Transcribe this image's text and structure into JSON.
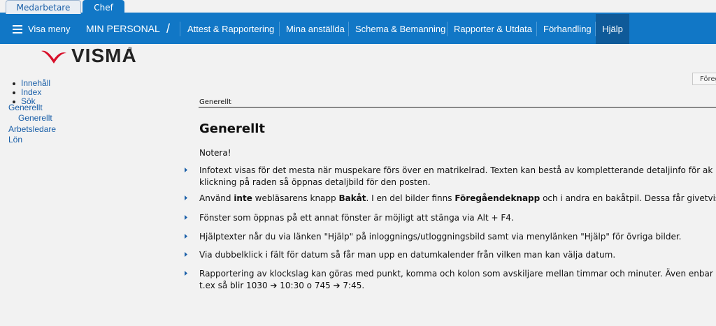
{
  "top_tabs": {
    "employee": "Medarbetare",
    "manager": "Chef"
  },
  "nav": {
    "menu": "Visa meny",
    "section": "MIN PERSONAL",
    "slash": "/",
    "items": [
      "Attest & Rapportering",
      "Mina anställda",
      "Schema & Bemanning",
      "Rapporter & Utdata",
      "Förhandling",
      "Hjälp"
    ]
  },
  "logo": {
    "text": "VISMA",
    "reg": "®"
  },
  "leftnav": {
    "links": [
      "Innehåll",
      "Index",
      "Sök"
    ],
    "tree": [
      "Generellt",
      "Generellt",
      "Arbetsledare",
      "Lön"
    ]
  },
  "prev_button": "Föregående",
  "content": {
    "breadcrumb": "Generellt",
    "title": "Generellt",
    "note": "Notera!",
    "i1a": "Infotext visas för det mesta när muspekare förs över en matrikelrad. Texten kan bestå av kompletterande detaljinfo för ak",
    "i1b": "klickning på raden så öppnas detaljbild för den posten.",
    "i2a": "Använd ",
    "i2b": "inte",
    "i2c": " webläsarens knapp ",
    "i2d": "Bakåt",
    "i2e": ". I en del bilder finns ",
    "i2f": "Föregåendeknapp",
    "i2g": " och i andra en bakåtpil. Dessa får givetvis",
    "i3": "Fönster som öppnas på ett annat fönster är möjligt att stänga via Alt + F4.",
    "i4": "Hjälptexter når du via länken \"Hjälp\" på inloggnings/utloggningsbild samt via menylänken \"Hjälp\" för övriga bilder.",
    "i5": "Via dubbelklick i fält för datum så får man upp en datumkalender från vilken man kan välja datum.",
    "i6a": "Rapportering av klockslag kan göras med punkt, komma och kolon som avskiljare mellan timmar och minuter. Även enbar",
    "i6b": "t.ex så blir 1030 ➔ 10:30 o 745 ➔ 7:45."
  },
  "colors": {
    "brand_blue": "#1177c6",
    "active_nav": "#0f5a99",
    "link": "#1a5fa8",
    "logo_red": "#d8102a"
  }
}
